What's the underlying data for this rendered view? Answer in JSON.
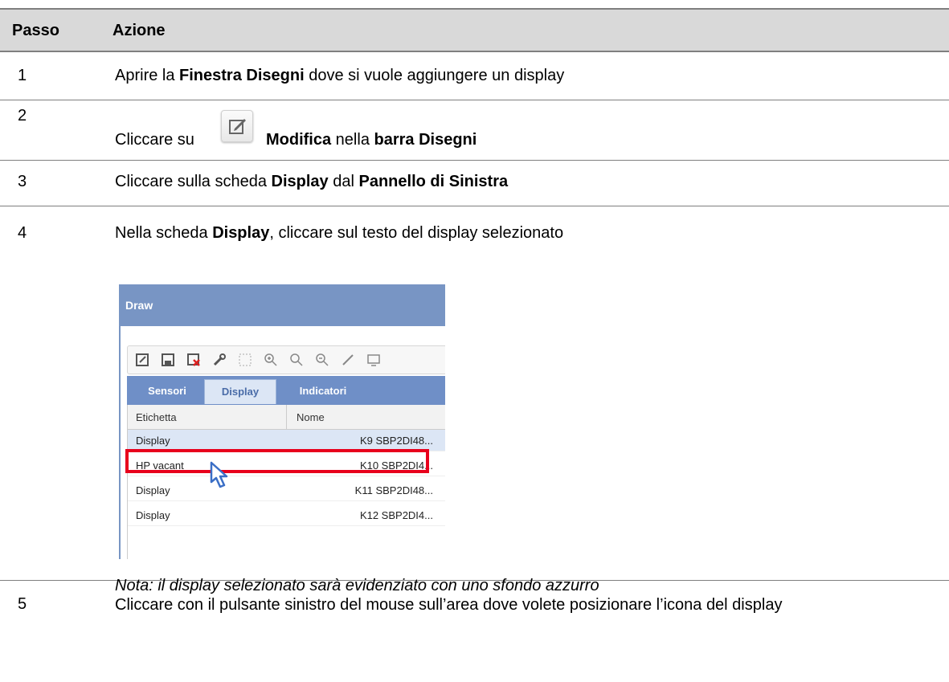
{
  "table": {
    "header": {
      "col1": "Passo",
      "col2": "Azione"
    },
    "rows": [
      {
        "num": "1",
        "parts": [
          "Aprire la ",
          "Finestra Disegni",
          " dove si vuole aggiungere un display"
        ]
      },
      {
        "num": "2",
        "parts": [
          "Cliccare su ",
          "Modifica",
          " nella ",
          "barra Disegni"
        ],
        "icon": "edit-icon"
      },
      {
        "num": "3",
        "parts": [
          "Cliccare sulla scheda ",
          "Display",
          " dal ",
          "Pannello di Sinistra"
        ]
      },
      {
        "num": "4",
        "parts": [
          "Nella scheda ",
          "Display",
          ", cliccare sul testo del display selezionato"
        ]
      },
      {
        "num": "5",
        "text": "Cliccare con il pulsante sinistro del mouse sull’area dove volete posizionare l’icona del display"
      }
    ],
    "note": "Nota: il display selezionato sarà evidenziato con uno sfondo azzurro"
  },
  "screenshot": {
    "window_title": "Draw",
    "tabs": [
      "Sensori",
      "Display",
      "Indicatori"
    ],
    "active_tab": "Display",
    "columns": [
      "Etichetta",
      "Nome"
    ],
    "rows": [
      {
        "label": "Display",
        "name": "K9 SBP2DI48...",
        "selected": true
      },
      {
        "label": "HP vacant",
        "name": "K10 SBP2DI4..."
      },
      {
        "label": "Display",
        "name": "K11 SBP2DI48..."
      },
      {
        "label": "Display",
        "name": "K12 SBP2DI4..."
      }
    ],
    "colors": {
      "titlebar": "#7895c4",
      "tabbar": "#6f8fc7",
      "selected_row": "#dce6f5",
      "highlight": "#e8001c"
    }
  }
}
